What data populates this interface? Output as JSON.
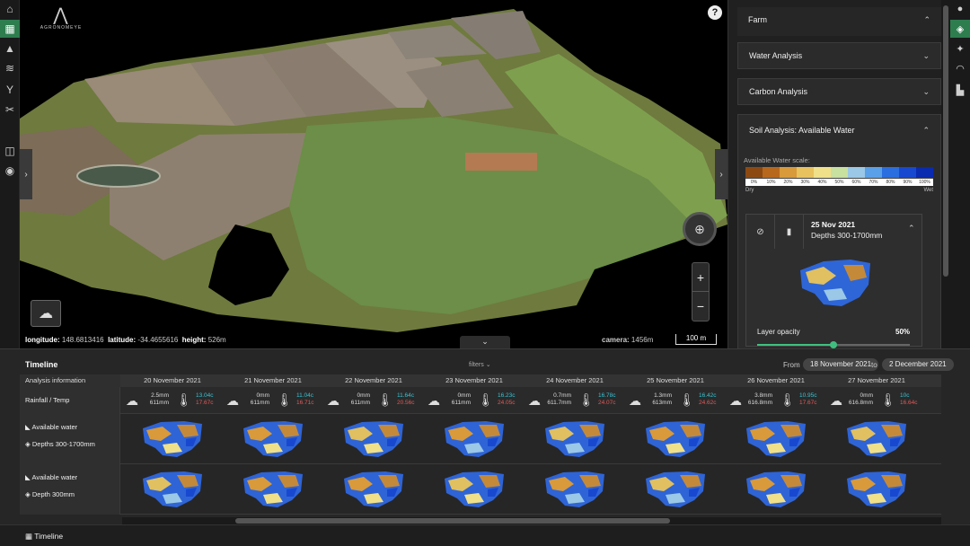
{
  "brand": {
    "name": "AGRONOMEYE"
  },
  "left_nav": [
    {
      "icon": "home-icon",
      "glyph": "⌂",
      "active": false
    },
    {
      "icon": "map-icon",
      "glyph": "▦",
      "active": true
    },
    {
      "icon": "terrain-icon",
      "glyph": "▲",
      "active": false
    },
    {
      "icon": "water-icon",
      "glyph": "≋",
      "active": false
    },
    {
      "icon": "plant-icon",
      "glyph": "Y",
      "active": false
    },
    {
      "icon": "tools-icon",
      "glyph": "✂",
      "active": false
    },
    {
      "icon": "compare-icon",
      "glyph": "◫",
      "active": false
    },
    {
      "icon": "camera-icon",
      "glyph": "◉",
      "active": false
    }
  ],
  "right_nav": [
    {
      "icon": "user-icon",
      "glyph": "●",
      "active": false
    },
    {
      "icon": "layers-icon",
      "glyph": "◈",
      "active": true
    },
    {
      "icon": "satellite-icon",
      "glyph": "✦",
      "active": false
    },
    {
      "icon": "signal-icon",
      "glyph": "◠",
      "active": false
    },
    {
      "icon": "building-icon",
      "glyph": "▙",
      "active": false
    }
  ],
  "map": {
    "help": "?",
    "longitude_label": "longitude:",
    "longitude": "148.6813416",
    "latitude_label": "latitude:",
    "latitude": "-34.4655616",
    "height_label": "height:",
    "height": "526m",
    "camera_label": "camera:",
    "camera": "1456m",
    "scale": "100 m",
    "zoom_in": "+",
    "zoom_out": "−",
    "collapse": "⌄"
  },
  "panel": {
    "farm": "Farm",
    "water_analysis": "Water Analysis",
    "carbon_analysis": "Carbon Analysis",
    "soil_analysis": "Soil Analysis: Available Water",
    "scale_label": "Available Water scale:",
    "scale_ticks": [
      "0%",
      "10%",
      "20%",
      "30%",
      "40%",
      "50%",
      "60%",
      "70%",
      "80%",
      "90%",
      "100%"
    ],
    "scale_colors": [
      "#8c4a12",
      "#b8681c",
      "#d89a3a",
      "#e8c25e",
      "#f0e08a",
      "#c8e0a0",
      "#9ac8e6",
      "#5aa0e8",
      "#2a6ee0",
      "#1848d0",
      "#0a2ab0"
    ],
    "dry": "Dry",
    "wet": "Wet",
    "layer_date": "25 Nov 2021",
    "layer_depth": "Depths 300-1700mm",
    "opacity_label": "Layer opacity",
    "opacity_value": "50%",
    "opacity_fraction": 0.5
  },
  "timeline": {
    "title": "Timeline",
    "filters": "filters",
    "from_label": "From",
    "from_date": "18 November 2021",
    "to_label": "to",
    "to_date": "2 December 2021",
    "analysis_info": "Analysis information",
    "rainfall_temp": "Rainfall / Temp",
    "dates": [
      "20 November 2021",
      "21 November 2021",
      "22 November 2021",
      "23 November 2021",
      "24 November 2021",
      "25 November 2021",
      "26 November 2021",
      "27 November 2021"
    ],
    "weather": [
      {
        "rain": "2.5mm",
        "cum": "611mm",
        "hi": "13.04c",
        "lo": "17.67c"
      },
      {
        "rain": "0mm",
        "cum": "611mm",
        "hi": "11.04c",
        "lo": "16.71c"
      },
      {
        "rain": "0mm",
        "cum": "611mm",
        "hi": "11.64c",
        "lo": "20.56c"
      },
      {
        "rain": "0mm",
        "cum": "611mm",
        "hi": "16.23c",
        "lo": "24.05c"
      },
      {
        "rain": "0.7mm",
        "cum": "611.7mm",
        "hi": "16.78c",
        "lo": "24.07c"
      },
      {
        "rain": "1.3mm",
        "cum": "613mm",
        "hi": "16.42c",
        "lo": "24.62c"
      },
      {
        "rain": "3.8mm",
        "cum": "616.8mm",
        "hi": "10.95c",
        "lo": "17.67c"
      },
      {
        "rain": "0mm",
        "cum": "616.8mm",
        "hi": "10c",
        "lo": "16.64c"
      }
    ],
    "rows": [
      {
        "layer": "Available water",
        "depth": "Depths 300-1700mm"
      },
      {
        "layer": "Available water",
        "depth": "Depth 300mm"
      }
    ]
  },
  "footer": {
    "label": "Timeline"
  }
}
